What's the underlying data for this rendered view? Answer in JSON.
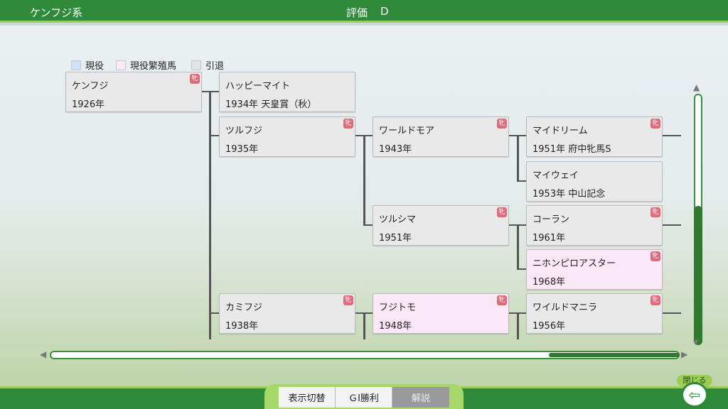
{
  "header": {
    "title": "ケンフジ系",
    "grade_label": "評価",
    "grade_value": "D"
  },
  "legend": [
    {
      "label": "現役",
      "color": "#cfe0f7"
    },
    {
      "label": "現役繁殖馬",
      "color": "#fbe8f6"
    },
    {
      "label": "引退",
      "color": "#e4e4e4"
    }
  ],
  "badge_icon": "牝",
  "horses": [
    {
      "name": "ケンフジ",
      "info": "1926年",
      "badge": true,
      "status": "retired"
    },
    {
      "name": "ハッピーマイト",
      "info": "1934年 天皇賞（秋）",
      "badge": false,
      "status": "retired"
    },
    {
      "name": "ツルフジ",
      "info": "1935年",
      "badge": true,
      "status": "retired"
    },
    {
      "name": "ワールドモア",
      "info": "1943年",
      "badge": true,
      "status": "retired"
    },
    {
      "name": "マイドリーム",
      "info": "1951年 府中牝馬S",
      "badge": true,
      "status": "retired"
    },
    {
      "name": "マイウェイ",
      "info": "1953年 中山記念",
      "badge": false,
      "status": "retired"
    },
    {
      "name": "ツルシマ",
      "info": "1951年",
      "badge": true,
      "status": "retired"
    },
    {
      "name": "コーラン",
      "info": "1961年",
      "badge": true,
      "status": "retired"
    },
    {
      "name": "ニホンピロアスター",
      "info": "1968年",
      "badge": true,
      "status": "breeding"
    },
    {
      "name": "カミフジ",
      "info": "1938年",
      "badge": true,
      "status": "retired"
    },
    {
      "name": "フジトモ",
      "info": "1948年",
      "badge": true,
      "status": "breeding"
    },
    {
      "name": "ワイルドマニラ",
      "info": "1956年",
      "badge": true,
      "status": "retired"
    }
  ],
  "scrollbars": {
    "vertical_position": 0.6,
    "horizontal_position": 0.85
  },
  "tabs": [
    {
      "label": "表示切替",
      "active": false
    },
    {
      "label": "ＧⅠ勝利",
      "active": false
    },
    {
      "label": "解説",
      "active": true
    }
  ],
  "close": {
    "label": "閉じる",
    "icon": "exit-icon"
  }
}
